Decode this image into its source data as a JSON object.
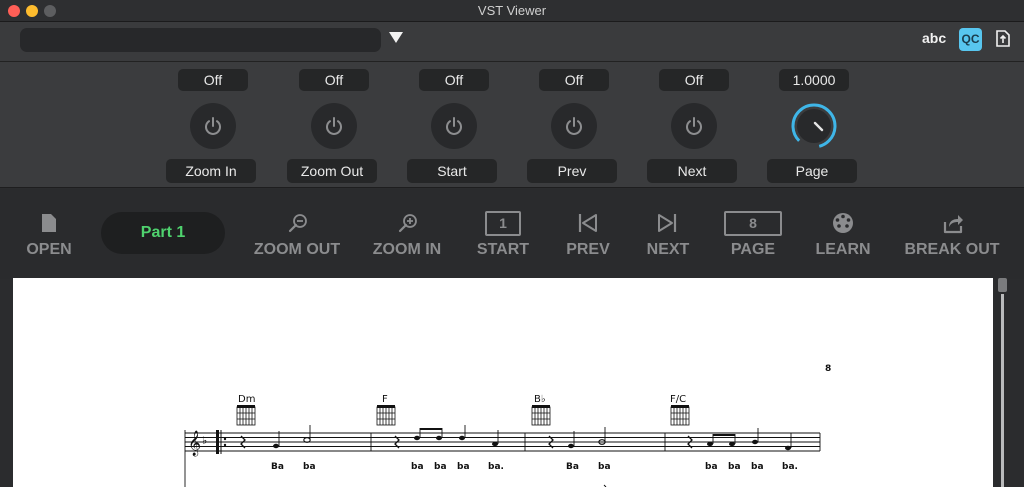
{
  "window": {
    "title": "VST Viewer"
  },
  "host": {
    "preset_value": "",
    "abc_label": "abc",
    "qc_label": "QC"
  },
  "params": [
    {
      "value": "Off",
      "label": "Zoom In",
      "kind": "toggle"
    },
    {
      "value": "Off",
      "label": "Zoom Out",
      "kind": "toggle"
    },
    {
      "value": "Off",
      "label": "Start",
      "kind": "toggle"
    },
    {
      "value": "Off",
      "label": "Prev",
      "kind": "toggle"
    },
    {
      "value": "Off",
      "label": "Next",
      "kind": "toggle"
    },
    {
      "value": "1.0000",
      "label": "Page",
      "kind": "knob"
    }
  ],
  "toolbar": {
    "open": "OPEN",
    "part": "Part  1",
    "zoom_out": "ZOOM OUT",
    "zoom_in": "ZOOM IN",
    "start": "START",
    "start_value": "1",
    "prev": "PREV",
    "next": "NEXT",
    "page": "PAGE",
    "page_value": "8",
    "learn": "LEARN",
    "break_out": "BREAK OUT"
  },
  "score": {
    "page_number": "8",
    "chords": [
      "Dm",
      "F",
      "B♭",
      "F/C"
    ],
    "lyrics": [
      "Ba",
      "ba",
      "ba",
      "ba",
      "ba",
      "ba.",
      "Ba",
      "ba",
      "ba",
      "ba",
      "ba",
      "ba."
    ]
  },
  "colors": {
    "accent_blue": "#58c6ef",
    "part_green": "#4fd26e",
    "knob_arc": "#3fb6e8"
  }
}
